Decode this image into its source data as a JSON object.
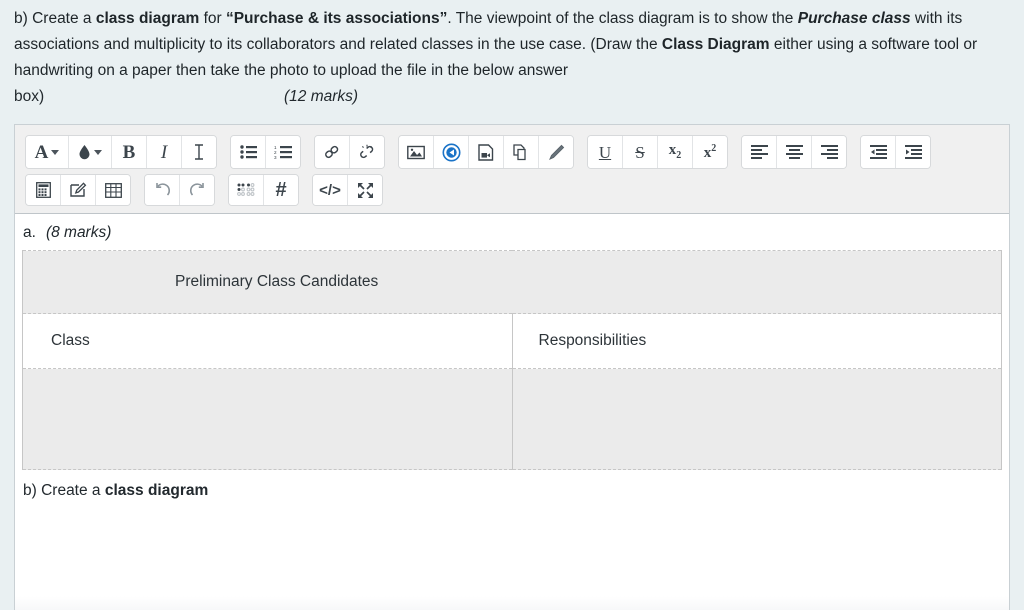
{
  "question": {
    "prefix": "b) Create a ",
    "bold1": "class diagram",
    "mid1": " for ",
    "bold2": "“Purchase & its associations”",
    "mid2": ". The viewpoint of the class diagram is to show the ",
    "italic1": "Purchase class",
    "mid3": " with its associations and multiplicity to its collaborators and related classes in the use case.  (Draw the ",
    "bold3": "Class Diagram",
    "mid4": " either using a software tool or handwriting on a paper then take the photo to upload the file in the below answer",
    "box_word": "box)",
    "marks": "(12 marks)"
  },
  "toolbar": {
    "row1": [
      {
        "group": 1,
        "name": "font-color-dropdown-button",
        "icon": "A-dropdown",
        "label": "A"
      },
      {
        "group": 1,
        "name": "highlight-color-dropdown-button",
        "icon": "droplet-dropdown",
        "label": ""
      },
      {
        "group": 1,
        "name": "bold-button",
        "icon": "bold",
        "label": "B"
      },
      {
        "group": 1,
        "name": "italic-button",
        "icon": "italic",
        "label": "I"
      },
      {
        "group": 1,
        "name": "text-cursor-button",
        "icon": "text-cursor",
        "label": ""
      },
      {
        "group": 2,
        "name": "bullet-list-button",
        "icon": "bullet-list",
        "label": ""
      },
      {
        "group": 2,
        "name": "numbered-list-button",
        "icon": "numbered-list",
        "label": ""
      },
      {
        "group": 3,
        "name": "insert-link-button",
        "icon": "link",
        "label": ""
      },
      {
        "group": 3,
        "name": "remove-link-button",
        "icon": "unlink",
        "label": ""
      },
      {
        "group": 4,
        "name": "insert-image-button",
        "icon": "image",
        "label": ""
      },
      {
        "group": 4,
        "name": "insert-audio-button",
        "icon": "audio",
        "label": ""
      },
      {
        "group": 4,
        "name": "insert-video-button",
        "icon": "video",
        "label": ""
      },
      {
        "group": 4,
        "name": "insert-file-button",
        "icon": "file-copy",
        "label": ""
      },
      {
        "group": 4,
        "name": "draw-button",
        "icon": "pencil",
        "label": ""
      },
      {
        "group": 5,
        "name": "underline-button",
        "icon": "underline",
        "label": "U"
      },
      {
        "group": 5,
        "name": "strikethrough-button",
        "icon": "strikethrough",
        "label": "S"
      },
      {
        "group": 5,
        "name": "subscript-button",
        "icon": "subscript",
        "label": "x"
      },
      {
        "group": 5,
        "name": "superscript-button",
        "icon": "superscript",
        "label": "x"
      },
      {
        "group": 6,
        "name": "align-left-button",
        "icon": "align-left",
        "label": ""
      },
      {
        "group": 6,
        "name": "align-center-button",
        "icon": "align-center",
        "label": ""
      },
      {
        "group": 6,
        "name": "align-right-button",
        "icon": "align-right",
        "label": ""
      },
      {
        "group": 7,
        "name": "outdent-button",
        "icon": "outdent",
        "label": ""
      },
      {
        "group": 7,
        "name": "indent-button",
        "icon": "indent",
        "label": ""
      }
    ],
    "row2": [
      {
        "group": 1,
        "name": "equation-editor-button",
        "icon": "calculator",
        "label": ""
      },
      {
        "group": 1,
        "name": "chemistry-editor-button",
        "icon": "edit-square",
        "label": ""
      },
      {
        "group": 1,
        "name": "insert-table-button",
        "icon": "table",
        "label": ""
      },
      {
        "group": 2,
        "name": "undo-button",
        "icon": "undo",
        "label": ""
      },
      {
        "group": 2,
        "name": "redo-button",
        "icon": "redo",
        "label": ""
      },
      {
        "group": 3,
        "name": "braille-button",
        "icon": "braille",
        "label": ""
      },
      {
        "group": 3,
        "name": "special-character-button",
        "icon": "hash",
        "label": "#"
      },
      {
        "group": 4,
        "name": "html-source-button",
        "icon": "code",
        "label": "</>"
      },
      {
        "group": 4,
        "name": "fullscreen-button",
        "icon": "expand",
        "label": ""
      }
    ]
  },
  "content": {
    "item_a_label": "a.",
    "item_a_marks": "(8 marks)",
    "table": {
      "caption": "Preliminary Class Candidates",
      "headers": [
        "Class",
        "Responsibilities"
      ],
      "rows": [
        [
          "",
          ""
        ]
      ]
    },
    "item_b_prefix": "b) Create a ",
    "item_b_bold": "class diagram"
  }
}
